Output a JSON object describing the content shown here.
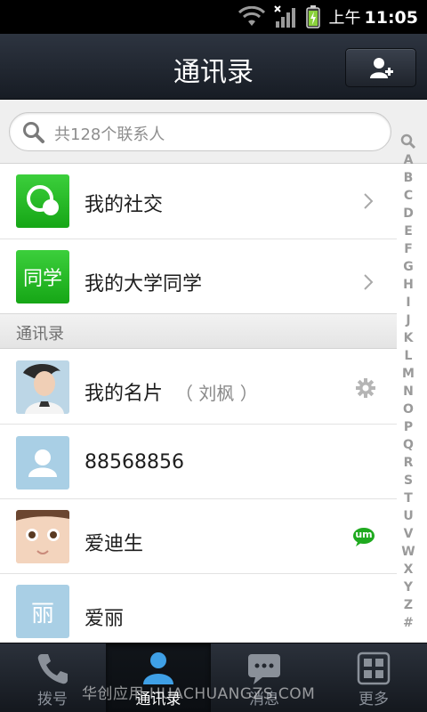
{
  "status_bar": {
    "ampm": "上午",
    "time": "11:05"
  },
  "header": {
    "title": "通讯录"
  },
  "search": {
    "placeholder": "共128个联系人"
  },
  "top_items": [
    {
      "label": "我的社交"
    },
    {
      "label": "我的大学同学",
      "tile_text": "同学"
    }
  ],
  "section": {
    "title": "通讯录"
  },
  "contacts": [
    {
      "name": "我的名片",
      "note": "（ 刘枫 ）"
    },
    {
      "name": "88568856"
    },
    {
      "name": "爱迪生",
      "badge": "um"
    },
    {
      "name": "爱丽",
      "tile_text": "丽"
    }
  ],
  "alpha_index": [
    "A",
    "B",
    "C",
    "D",
    "E",
    "F",
    "G",
    "H",
    "I",
    "J",
    "K",
    "L",
    "M",
    "N",
    "O",
    "P",
    "Q",
    "R",
    "S",
    "T",
    "U",
    "V",
    "W",
    "X",
    "Y",
    "Z",
    "#"
  ],
  "tabs": [
    {
      "label": "拨号"
    },
    {
      "label": "通讯录"
    },
    {
      "label": "消息"
    },
    {
      "label": "更多"
    }
  ],
  "watermark": "华创应用 HUACHUANGZS.COM",
  "colors": {
    "accent_green": "#1faa1f",
    "accent_blue": "#3fa0e6",
    "tile_blue": "#a9cfe5"
  }
}
